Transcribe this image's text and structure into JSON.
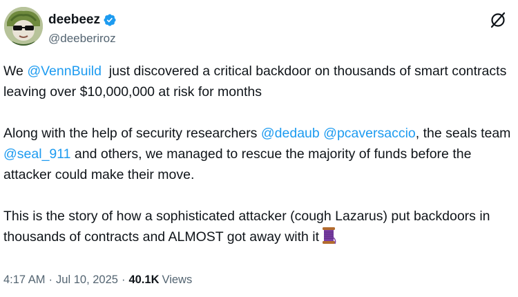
{
  "author": {
    "display_name": "deebeez",
    "handle": "@deeberiroz",
    "verified": true,
    "verified_color": "#1d9bf0"
  },
  "tweet": {
    "p1": {
      "t0": "We ",
      "m0": "@VennBuild",
      "t1": "  just discovered a critical backdoor on thousands of smart contracts leaving over $10,000,000 at risk for months"
    },
    "p2": {
      "t0": "Along with the help of security researchers ",
      "m0": "@dedaub",
      "t1": " ",
      "m1": "@pcaversaccio",
      "t2": ", the seals team ",
      "m2": "@seal_911",
      "t3": " and others, we managed to rescue the majority of funds before the attacker could make their move."
    },
    "p3": {
      "t0": "This is the story of how a sophisticated attacker (cough Lazarus) put backdoors in thousands of contracts and ALMOST got away with it",
      "emoji": "thread-spool-icon"
    }
  },
  "meta": {
    "time": "4:17 AM",
    "date": "Jul 10, 2025",
    "views_count": "40.1K",
    "views_label": "Views",
    "sep": "·"
  },
  "colors": {
    "text": "#0f1419",
    "secondary": "#536471",
    "link": "#1d9bf0"
  }
}
